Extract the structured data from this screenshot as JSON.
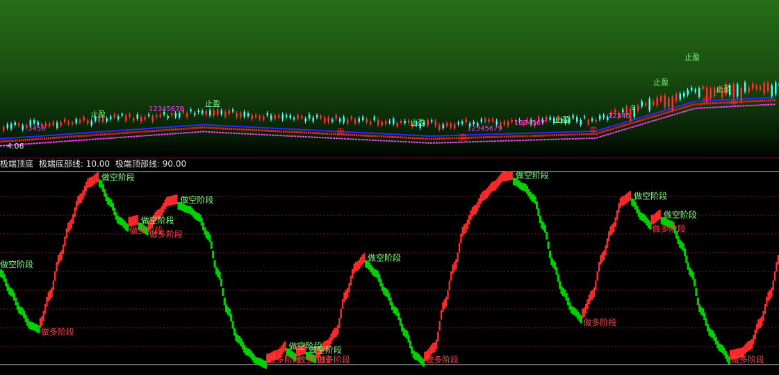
{
  "chart_data": [
    {
      "type": "candlestick",
      "price_label": "4.06",
      "signal_labels": [
        "止盈",
        "止盈",
        "止盈",
        "止盈",
        "止盈",
        "止盈",
        "止盈",
        "卖",
        "卖",
        "卖",
        "卖",
        "卖",
        "9",
        "12345678",
        "1234567",
        "12345679",
        "12345",
        "3456"
      ],
      "colors": {
        "ma_upper": "#2c2cff",
        "ma_red": "#ff2020",
        "ma_magenta": "#ff40ff",
        "up": "#ff3030",
        "down": "#40ffff",
        "stop": "#7fff7f"
      }
    },
    {
      "type": "area",
      "indicator_title": "极端顶底",
      "bottom_line_label": "极端底部线: 10.00",
      "top_line_label": "极端顶部线: 90.00",
      "ylim": [
        0,
        100
      ],
      "bottom_line": 10,
      "top_line": 90,
      "phase_labels": {
        "short": "做空阶段",
        "long": "做多阶段"
      },
      "colors": {
        "rising": "#ff2a2a",
        "falling": "#00d000",
        "short_text": "#7fff7f",
        "long_text": "#ff4040",
        "grid": "#8a1a1a"
      },
      "series": {
        "values": [
          50,
          40,
          30,
          22,
          20,
          35,
          55,
          72,
          86,
          95,
          98,
          88,
          78,
          74,
          75,
          72,
          78,
          85,
          86,
          84,
          80,
          70,
          50,
          30,
          15,
          8,
          3,
          1,
          3,
          8,
          5,
          6,
          4,
          8,
          15,
          35,
          50,
          55,
          50,
          40,
          30,
          18,
          6,
          2,
          7,
          30,
          50,
          70,
          80,
          88,
          93,
          98,
          99,
          96,
          90,
          75,
          55,
          40,
          30,
          25,
          35,
          55,
          70,
          85,
          88,
          80,
          75,
          78,
          76,
          65,
          50,
          30,
          18,
          10,
          3,
          4,
          8,
          20,
          35,
          55
        ]
      }
    }
  ]
}
